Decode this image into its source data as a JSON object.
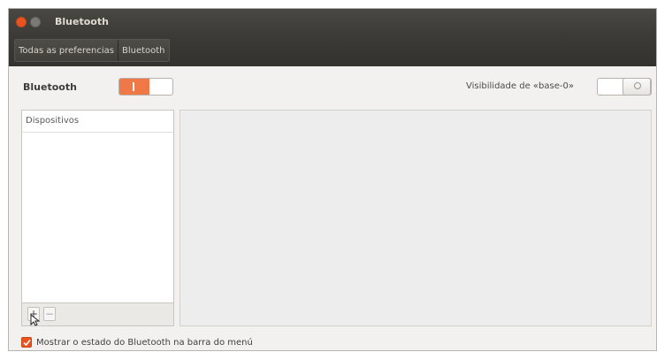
{
  "window": {
    "title": "Bluetooth"
  },
  "breadcrumbs": [
    "Todas as preferencias",
    "Bluetooth"
  ],
  "bluetooth": {
    "label": "Bluetooth",
    "enabled": true
  },
  "visibility": {
    "label": "Visibilidade de «base-0»",
    "enabled": false
  },
  "devices": {
    "header": "Dispositivos",
    "add_label": "+",
    "remove_label": "−"
  },
  "show_status": {
    "label": "Mostrar o estado do Bluetooth na barra do menú",
    "checked": true
  },
  "colors": {
    "accent": "#e95420",
    "toggle_on": "#f07746",
    "titlebar": "#3c3b37"
  }
}
